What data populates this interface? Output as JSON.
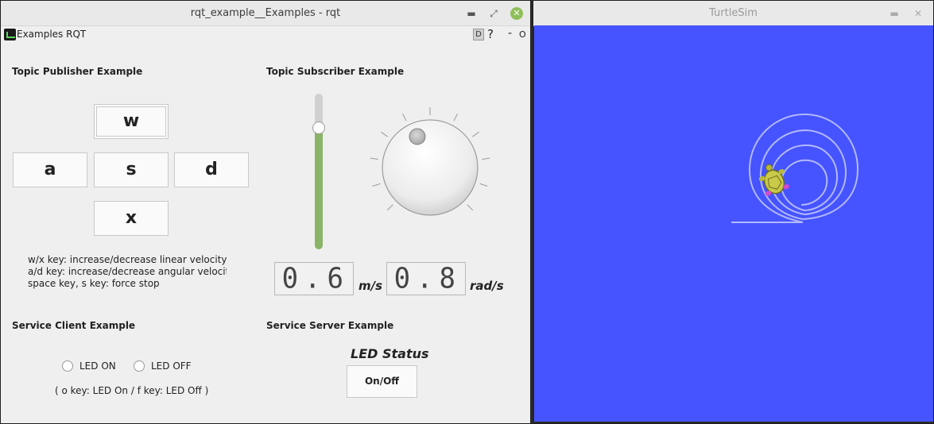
{
  "rqt_window": {
    "title": "rqt_example__Examples - rqt",
    "controls": {
      "minimize": "▪",
      "maximize": "▪",
      "close": "✕"
    }
  },
  "plugin_bar": {
    "title": "Examples RQT",
    "d_button": "D",
    "help_button": "?",
    "minimize_button": "-",
    "close_button": "O"
  },
  "publisher": {
    "title": "Topic Publisher Example",
    "keys": {
      "w": "w",
      "a": "a",
      "s": "s",
      "d": "d",
      "x": "x"
    },
    "help_lines": [
      "w/x key: increase/decrease linear velocity",
      "a/d key: increase/decrease angular velocity",
      "space key, s key: force stop"
    ]
  },
  "subscriber": {
    "title": "Topic Subscriber Example",
    "linear_slider_fraction": 0.82,
    "dial_value_fraction": 0.4,
    "linear_display": "0.6",
    "linear_unit": "m/s",
    "angular_display": "0.8",
    "angular_unit": "rad/s"
  },
  "service_client": {
    "title": "Service Client Example",
    "led_on_label": "LED ON",
    "led_off_label": "LED OFF",
    "note": "( o key: LED On / f key: LED Off )"
  },
  "service_server": {
    "title": "Service Server Example",
    "status_title": "LED Status",
    "button_label": "On/Off"
  },
  "turtlesim_window": {
    "title": "TurtleSim",
    "background_color": "#4554ff",
    "trail_color": "#b3b8ff"
  },
  "colors": {
    "slider_fill": "#8ab467",
    "turtle_shell": "#c9c94a"
  }
}
